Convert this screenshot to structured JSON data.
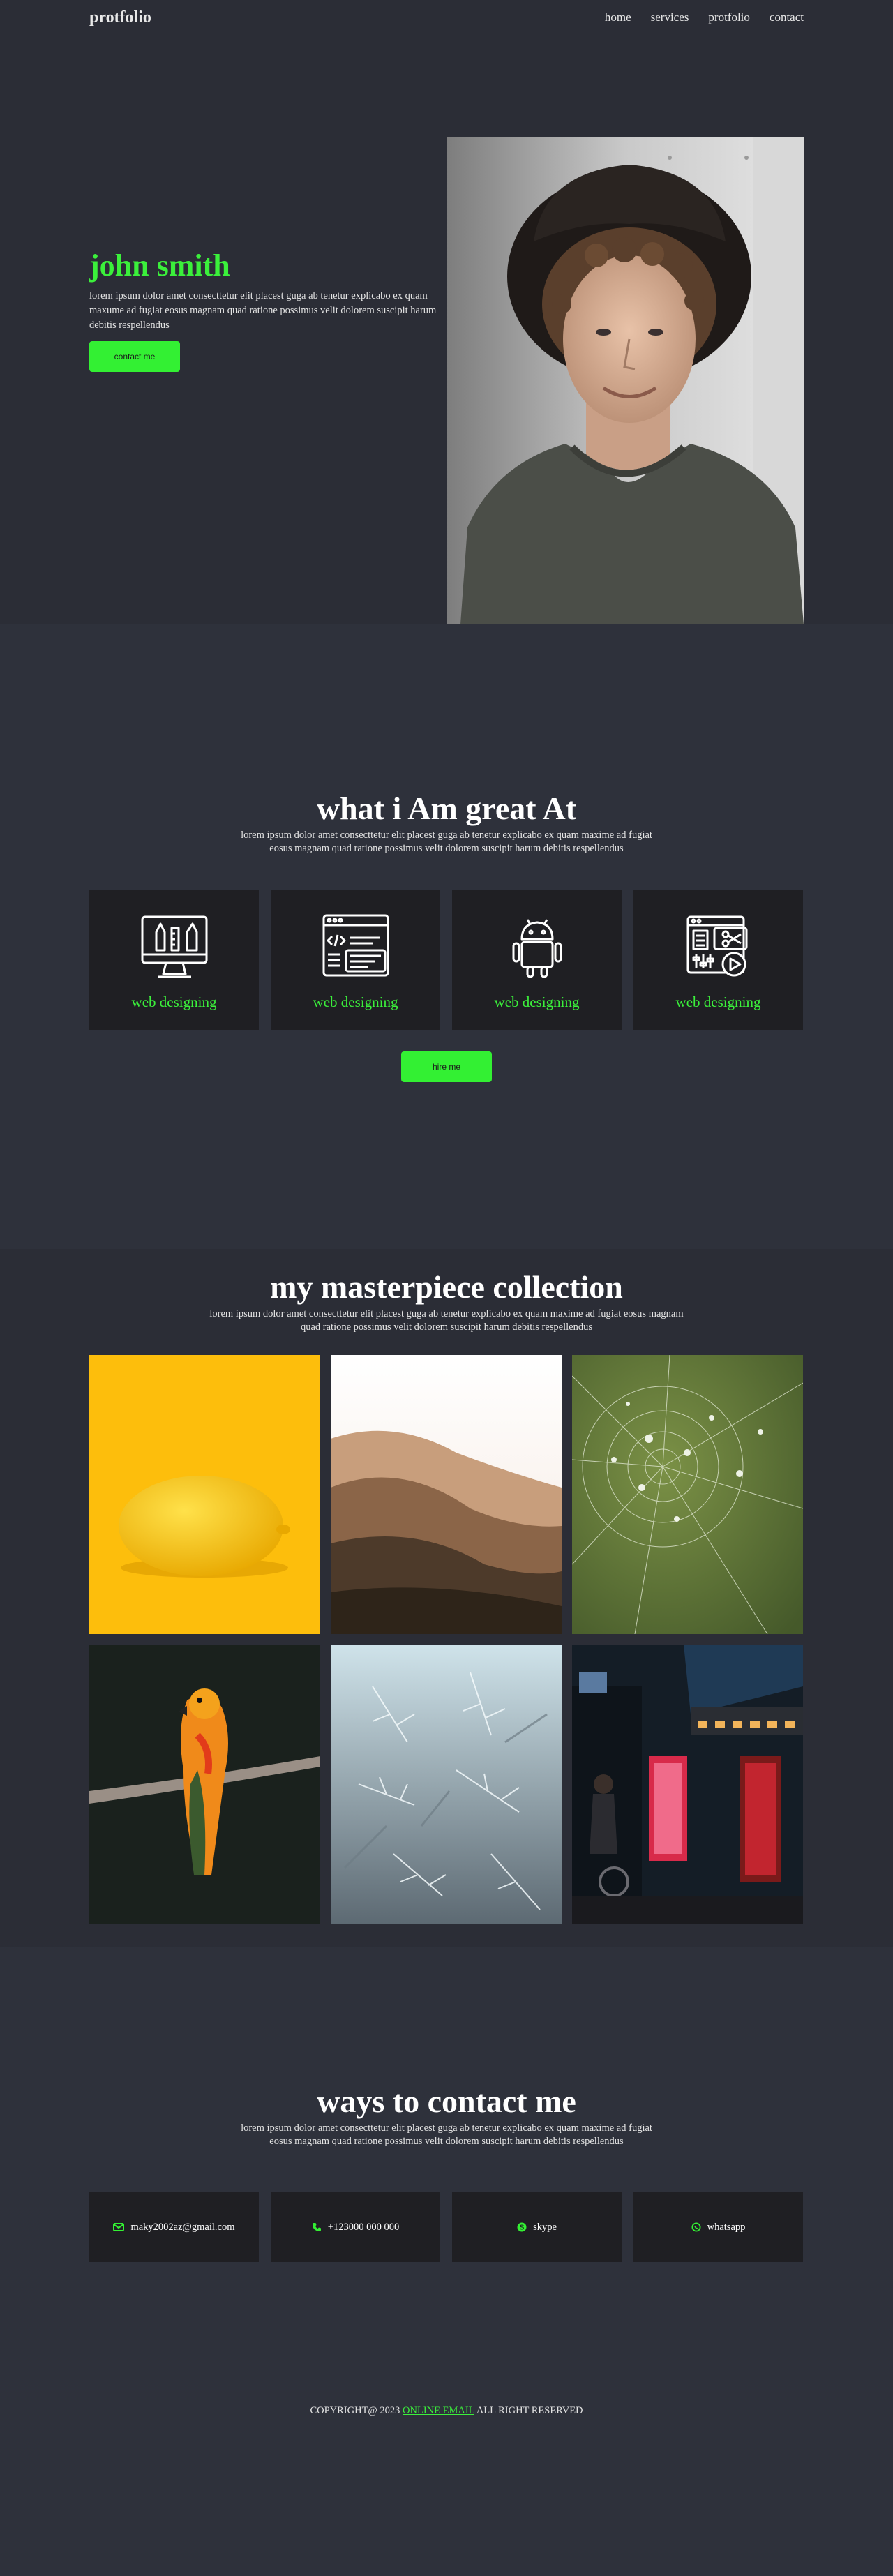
{
  "header": {
    "logo": "protfolio",
    "nav": [
      "home",
      "services",
      "protfolio",
      "contact"
    ]
  },
  "hero": {
    "name": "john smith",
    "text": "lorem ipsum dolor amet consecttetur elit placest guga ab tenetur explicabo ex quam maxume ad fugiat eosus magnam quad ratione possimus velit dolorem suscipit harum debitis respellendus",
    "button": "contact me"
  },
  "skills": {
    "title": "what i Am great At",
    "text": "lorem ipsum dolor amet consecttetur elit placest guga ab tenetur explicabo ex quam maxime ad fugiat eosus magnam quad ratione possimus velit dolorem suscipit harum debitis respellendus",
    "cards": [
      {
        "label": "web designing",
        "icon": "design-tools-icon"
      },
      {
        "label": "web designing",
        "icon": "code-browser-icon"
      },
      {
        "label": "web designing",
        "icon": "android-icon"
      },
      {
        "label": "web designing",
        "icon": "media-editing-icon"
      }
    ],
    "button": "hire me"
  },
  "gallery": {
    "title": "my masterpiece collection",
    "text": "lorem ipsum dolor amet consecttetur elit placest guga ab tenetur explicabo ex quam maxime ad fugiat eosus magnam quad ratione possimus velit dolorem suscipit harum debitis respellendus"
  },
  "contact": {
    "title": "ways to contact me",
    "text": "lorem ipsum dolor amet consecttetur elit placest guga ab tenetur explicabo ex quam maxime ad fugiat eosus magnam quad ratione possimus velit dolorem suscipit harum debitis respellendus",
    "cards": [
      {
        "label": "maky2002az@gmail.com",
        "icon": "envelope-icon"
      },
      {
        "label": "+123000 000 000",
        "icon": "phone-icon"
      },
      {
        "label": "skype",
        "icon": "skype-icon"
      },
      {
        "label": "whatsapp",
        "icon": "whatsapp-icon"
      }
    ]
  },
  "footer": {
    "prefix": "COPYRIGHT@ 2023",
    "link": "ONLINE EMAIL",
    "suffix": "ALL RIGHT RESERVED"
  },
  "colors": {
    "accent": "#33f033",
    "background": "#2b2d36",
    "card": "#1f1f23"
  }
}
